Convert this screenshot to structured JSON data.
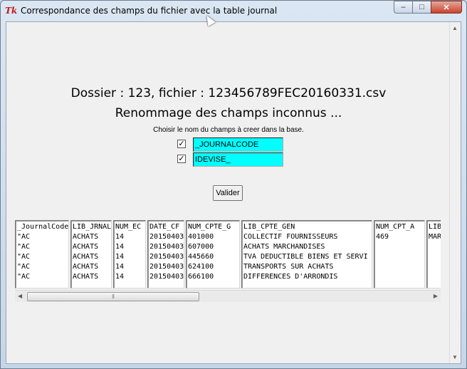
{
  "window": {
    "title": "Correspondance des champs du fichier avec la table journal",
    "icon_label": "Tk",
    "buttons": {
      "minimize": "–",
      "maximize": "□",
      "close": "✕"
    }
  },
  "form": {
    "heading": "Dossier : 123, fichier : 123456789FEC20160331.csv",
    "subheading": "Renommage des champs inconnus  ...",
    "instruction": "Choisir le nom du champs à creer dans la base.",
    "fields": [
      {
        "checked": true,
        "check_glyph": "✓",
        "value": "_JOURNALCODE"
      },
      {
        "checked": true,
        "check_glyph": "✓",
        "value": "IDEVISE_"
      }
    ],
    "submit_label": "Valider"
  },
  "table": {
    "columns": [
      {
        "header": "_JournalCode",
        "cells": [
          "\"AC",
          "\"AC",
          "\"AC",
          "\"AC",
          "\"AC"
        ]
      },
      {
        "header": "LIB_JRNAL",
        "cells": [
          "ACHATS",
          "ACHATS",
          "ACHATS",
          "ACHATS",
          "ACHATS"
        ]
      },
      {
        "header": "NUM_EC",
        "cells": [
          "14",
          "14",
          "14",
          "14",
          "14"
        ]
      },
      {
        "header": "DATE_CF",
        "cells": [
          "20150403",
          "20150403",
          "20150403",
          "20150403",
          "20150403"
        ]
      },
      {
        "header": "NUM_CPTE_G",
        "cells": [
          "401000",
          "607000",
          "445660",
          "624100",
          "666100"
        ]
      },
      {
        "header": "LIB_CPTE_GEN",
        "cells": [
          "COLLECTIF FOURNISSEURS",
          "ACHATS MARCHANDISES",
          "TVA DEDUCTIBLE BIENS ET SERVI",
          "TRANSPORTS SUR ACHATS",
          "DIFFERENCES D'ARRONDIS"
        ]
      },
      {
        "header": "NUM_CPT_A",
        "cells": [
          "469",
          "",
          "",
          "",
          ""
        ]
      },
      {
        "header": "LIB_",
        "cells": [
          "MAR",
          "",
          "",
          "",
          ""
        ]
      }
    ],
    "hscroll_grip": "⦀"
  }
}
